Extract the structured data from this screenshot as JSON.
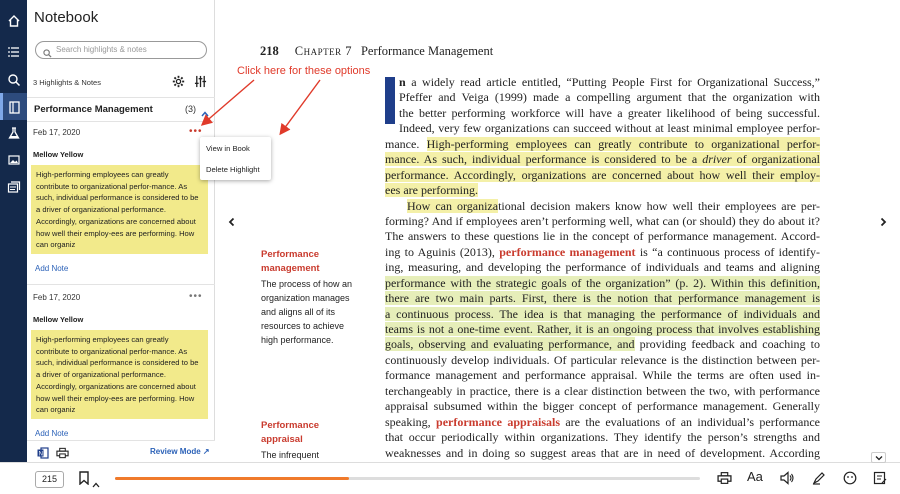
{
  "sidebar": {
    "icons": [
      "home-icon",
      "list-icon",
      "search-icon",
      "notebook-icon",
      "flask-icon",
      "image-icon",
      "flashcards-icon",
      "settings-icon"
    ]
  },
  "notebook": {
    "title": "Notebook",
    "search_placeholder": "Search highlights & notes",
    "count_label": "3 Highlights & Notes",
    "section": {
      "title": "Performance Management",
      "count": "(3)"
    },
    "notes": [
      {
        "date": "Feb 17, 2020",
        "color_label": "Mellow Yellow",
        "text": "High-performing employees can greatly contribute to organizational perfor-mance. As such, individual performance is considered to be a driver of organizational performance. Accordingly, organizations are concerned about how well their employ-ees are performing. How can organiz",
        "add_note": "Add Note"
      },
      {
        "date": "Feb 17, 2020",
        "color_label": "Mellow Yellow",
        "text": "High-performing employees can greatly contribute to organizational perfor-mance. As such, individual performance is considered to be a driver of organizational performance. Accordingly, organizations are concerned about how well their employ-ees are performing. How can organiz",
        "add_note": "Add Note"
      }
    ],
    "review_mode": "Review Mode"
  },
  "context_menu": {
    "items": [
      "View in Book",
      "Delete Highlight"
    ]
  },
  "callout": "Click here for these options",
  "reader": {
    "page_number": "218",
    "chapter": "Chapter 7",
    "chapter_title": "Performance Management",
    "margin": [
      {
        "term_lines": [
          "Performance",
          "management"
        ],
        "def_lines": [
          "The process of how an",
          "organization manages",
          "and aligns all of its",
          "resources to achieve",
          "high performance."
        ]
      },
      {
        "term_lines": [
          "Performance",
          "appraisal"
        ],
        "def_lines": [
          "The infrequent"
        ]
      }
    ]
  },
  "bottom": {
    "page_input": "215",
    "progress": 0.4
  },
  "colors": {
    "accent": "#f07a2b",
    "rail": "#14294b",
    "highlight_yellow": "#f2ea8b",
    "key_term": "#c93b2e",
    "link": "#2c62b8"
  }
}
